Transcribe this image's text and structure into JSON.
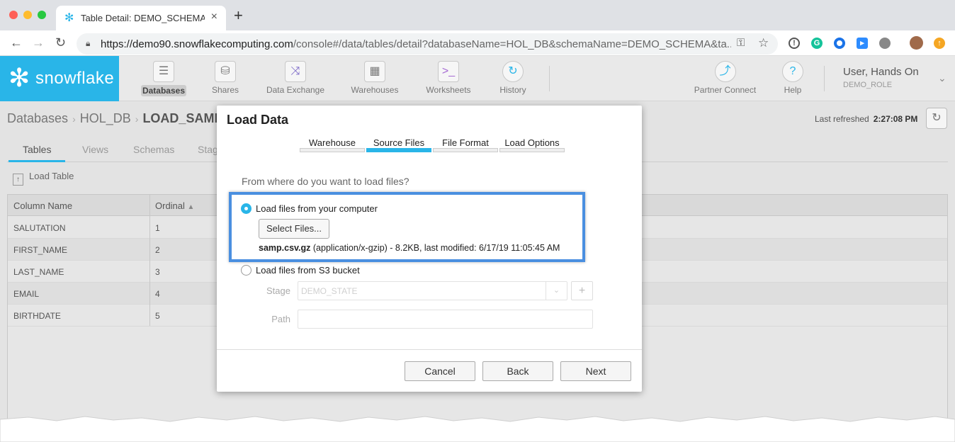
{
  "browser": {
    "tab_title": "Table Detail: DEMO_SCHEMA.L",
    "tab_close": "×",
    "new_tab": "+",
    "url_host": "https://demo90.snowflakecomputing.com",
    "url_path": "/console#/data/tables/detail?databaseName=HOL_DB&schemaName=DEMO_SCHEMA&ta...",
    "traffic_colors": [
      "#fe5f57",
      "#febc2e",
      "#28c840"
    ]
  },
  "app": {
    "logo_text": "snowflake",
    "nav": [
      {
        "label": "Databases",
        "icon": "database-icon"
      },
      {
        "label": "Shares",
        "icon": "shares-icon"
      },
      {
        "label": "Data Exchange",
        "icon": "shuffle-icon"
      },
      {
        "label": "Warehouses",
        "icon": "warehouse-grid-icon"
      },
      {
        "label": "Worksheets",
        "icon": "terminal-icon"
      },
      {
        "label": "History",
        "icon": "history-icon"
      },
      {
        "label": "Partner Connect",
        "icon": "partner-connect-icon"
      },
      {
        "label": "Help",
        "icon": "help-icon"
      }
    ],
    "user": {
      "name": "User, Hands On",
      "role": "DEMO_ROLE"
    },
    "accent": "#29b5e8"
  },
  "page": {
    "breadcrumb": [
      "Databases",
      "HOL_DB",
      "LOAD_SAMP"
    ],
    "last_refreshed_label": "Last refreshed",
    "last_refreshed_time": "2:27:08 PM",
    "tabs": [
      "Tables",
      "Views",
      "Schemas",
      "Stag"
    ],
    "load_table": "Load Table",
    "columns": [
      "Column Name",
      "Ordinal"
    ],
    "rows": [
      {
        "name": "SALUTATION",
        "ordinal": "1"
      },
      {
        "name": "FIRST_NAME",
        "ordinal": "2"
      },
      {
        "name": "LAST_NAME",
        "ordinal": "3"
      },
      {
        "name": "EMAIL",
        "ordinal": "4"
      },
      {
        "name": "BIRTHDATE",
        "ordinal": "5"
      }
    ]
  },
  "modal": {
    "title": "Load Data",
    "steps": [
      "Warehouse",
      "Source Files",
      "File Format",
      "Load Options"
    ],
    "active_step": "Source Files",
    "question": "From where do you want to load files?",
    "option_computer": "Load files from your computer",
    "select_files": "Select Files...",
    "file_name": "samp.csv.gz",
    "file_detail": " (application/x-gzip) - 8.2KB, last modified: 6/17/19 11:05:45 AM",
    "option_s3": "Load files from S3 bucket",
    "stage_label": "Stage",
    "stage_value": "DEMO_STATE",
    "path_label": "Path",
    "cancel": "Cancel",
    "back": "Back",
    "next": "Next"
  }
}
